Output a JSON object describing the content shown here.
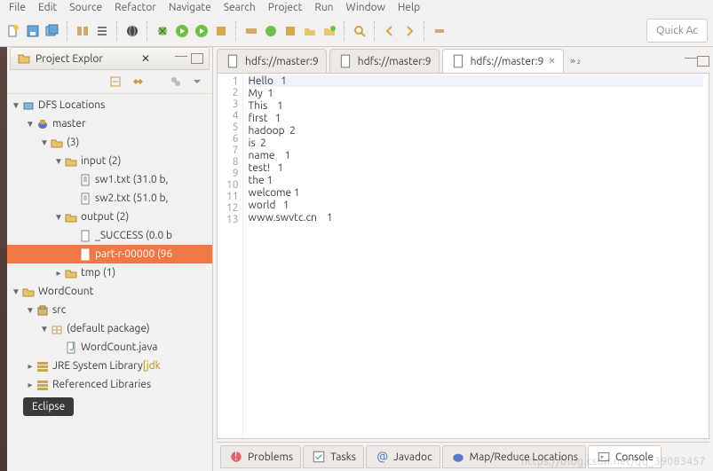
{
  "menubar": [
    "File",
    "Edit",
    "Source",
    "Refactor",
    "Navigate",
    "Search",
    "Project",
    "Run",
    "Window",
    "Help"
  ],
  "quick_access_placeholder": "Quick Ac",
  "project_explorer": {
    "title": "Project Explor",
    "tree": {
      "root": "DFS Locations",
      "master": "master",
      "count3": "(3)",
      "input": "input (2)",
      "sw1": "sw1.txt (31.0 b,",
      "sw2": "sw2.txt (51.0 b,",
      "output": "output (2)",
      "success": "_SUCCESS (0.0 b",
      "part": "part-r-00000 (96",
      "tmp": "tmp (1)",
      "wordcount": "WordCount",
      "src": "src",
      "pkg": "(default package)",
      "wcjava": "WordCount.java",
      "jre": "JRE System Library ",
      "jre_suffix": "[jdk",
      "reflib": "Referenced Libraries"
    }
  },
  "editor": {
    "tabs": [
      {
        "label": "hdfs://master:9",
        "active": false
      },
      {
        "label": "hdfs://master:9",
        "active": false
      },
      {
        "label": "hdfs://master:9",
        "active": true
      }
    ],
    "lines": [
      "Hello   1",
      "My  1",
      "This    1",
      "first   1",
      "hadoop  2",
      "is  2",
      "name    1",
      "test!   1",
      "the 1",
      "welcome 1",
      "world   1",
      "www.swvtc.cn    1",
      ""
    ]
  },
  "bottom": {
    "tabs": [
      "Problems",
      "Tasks",
      "Javadoc",
      "Map/Reduce Locations",
      "Console"
    ]
  },
  "tooltip": "Eclipse",
  "watermark": "https://blog.csdn.net/qq_39083457"
}
